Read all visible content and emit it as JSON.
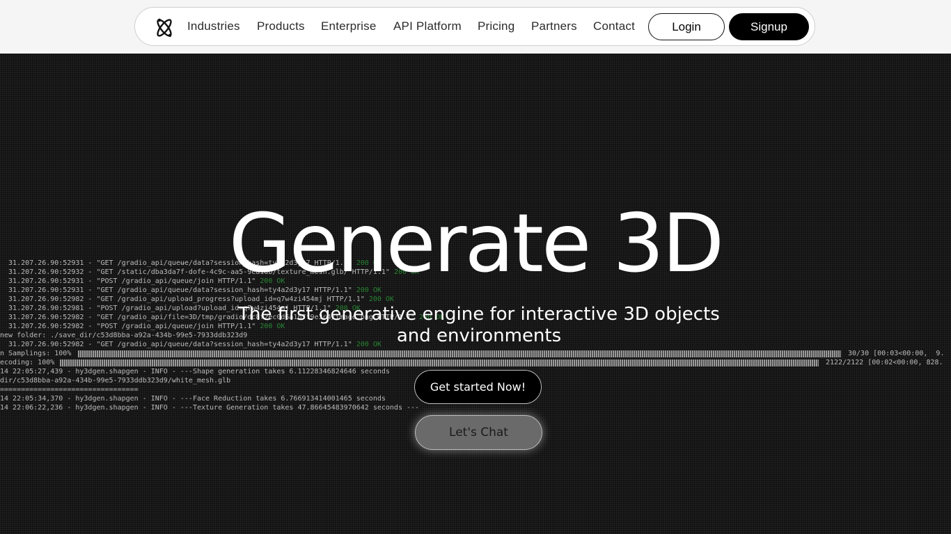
{
  "nav": {
    "logo_icon": "atom-x-logo-icon",
    "links": [
      "Industries",
      "Products",
      "Enterprise",
      "API Platform",
      "Pricing",
      "Partners",
      "Contact"
    ],
    "login_label": "Login",
    "signup_label": "Signup"
  },
  "hero": {
    "title": "Generate 3D",
    "subtitle": "The first generative engine for interactive 3D objects and environments",
    "cta_primary": "Get started Now!",
    "cta_secondary": "Let's Chat"
  },
  "terminal": {
    "lines": [
      {
        "text": "                                           _",
        "ok": ""
      },
      {
        "text": "  31.207.26.90:52931 - \"GET /gradio_api/queue/data?session_hash=ty4a2d3y17 HTTP/1.1\"",
        "ok": " 200 OK"
      },
      {
        "text": "  31.207.26.90:52932 - \"GET /static/dba3da7f-dofe-4c9c-aa5-9ea1db/texture_mesh.glb/ HTTP/1.1\"",
        "ok": " 200 OK"
      },
      {
        "text": "  31.207.26.90:52931 - \"POST /gradio_api/queue/join HTTP/1.1\"",
        "ok": " 200 OK"
      },
      {
        "text": "  31.207.26.90:52931 - \"GET /gradio_api/queue/data?session_hash=ty4a2d3y17 HTTP/1.1\"",
        "ok": " 200 OK"
      },
      {
        "text": "  31.207.26.90:52982 - \"GET /gradio_api/upload_progress?upload_id=q7w4zi454mj HTTP/1.1\"",
        "ok": " 200 OK"
      },
      {
        "text": "  31.207.26.90:52981 - \"POST /gradio_api/upload?upload_id=q7w4zi454mj HTTP/1.1\"",
        "ok": " 200 OK"
      },
      {
        "text": "  31.207.26.90:52982 - \"GET /gradio_api/file=3D/tmp/gradio/dc8f2ec0d6a1b7f9e3c4/image.png HTTP/1.1\"",
        "ok": " 200 OK"
      },
      {
        "text": "  31.207.26.90:52982 - \"POST /gradio_api/queue/join HTTP/1.1\"",
        "ok": " 200 OK"
      },
      {
        "text": "new folder: ./save_dir/c53d8bba-a92a-434b-99e5-7933ddb323d9",
        "ok": ""
      },
      {
        "text": "  31.207.26.90:52982 - \"GET /gradio_api/queue/data?session_hash=ty4a2d3y17 HTTP/1.1\"",
        "ok": " 200 OK"
      },
      {
        "text": "n Samplings: 100%",
        "ok": ""
      },
      {
        "text": "ecoding: 100%",
        "ok": ""
      },
      {
        "text": "14 22:05:27,439 - hy3dgen.shapgen - INFO - ---Shape generation takes 6.11228346824646 seconds",
        "ok": ""
      },
      {
        "text": "dir/c53d8bba-a92a-434b-99e5-7933ddb323d9/white_mesh.glb",
        "ok": ""
      },
      {
        "text": "=================================",
        "ok": ""
      },
      {
        "text": "14 22:05:34,370 - hy3dgen.shapgen - INFO - ---Face Reduction takes 6.766913414001465 seconds",
        "ok": ""
      },
      {
        "text": "14 22:06:22,236 - hy3dgen.shapgen - INFO - ---Texture Generation takes 47.86645483970642 seconds ---",
        "ok": ""
      }
    ],
    "progress_1_text": "30/30 [00:03<00:00,  9.",
    "progress_2_text": "2122/2122 [00:02<00:00, 828."
  }
}
